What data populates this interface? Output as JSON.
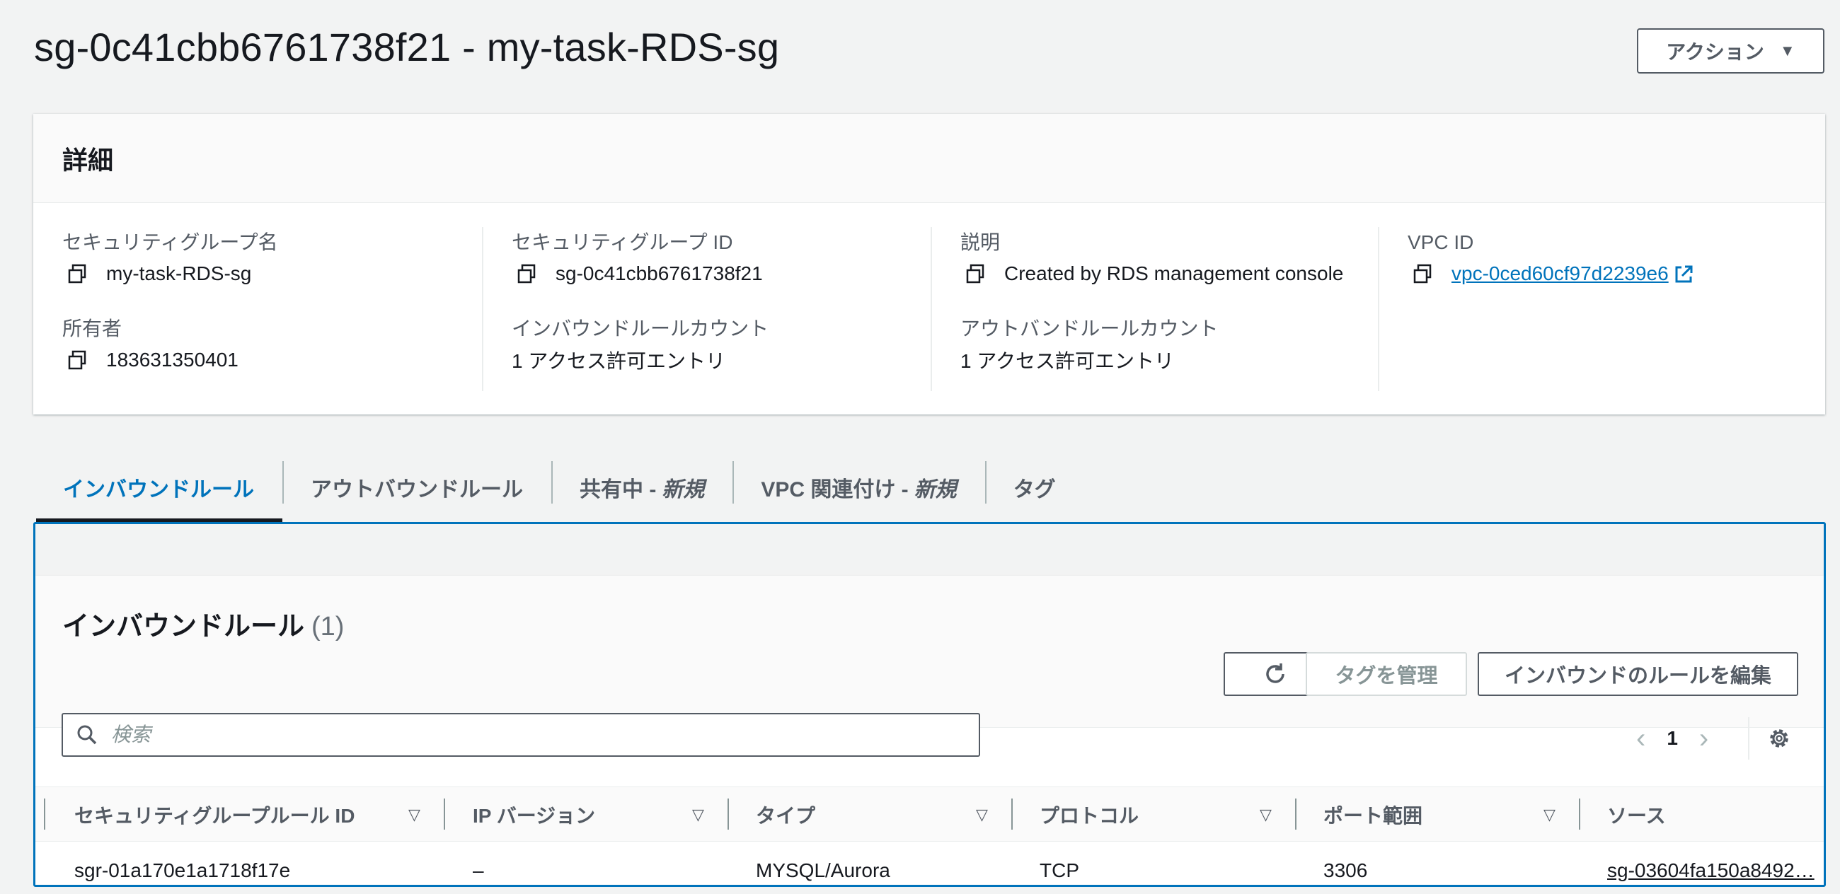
{
  "page": {
    "title": "sg-0c41cbb6761738f21 - my-task-RDS-sg",
    "actions_label": "アクション"
  },
  "details": {
    "heading": "詳細",
    "sg_name_label": "セキュリティグループ名",
    "sg_name_value": "my-task-RDS-sg",
    "sg_id_label": "セキュリティグループ ID",
    "sg_id_value": "sg-0c41cbb6761738f21",
    "description_label": "説明",
    "description_value": "Created by RDS management console",
    "vpc_id_label": "VPC ID",
    "vpc_id_value": "vpc-0ced60cf97d2239e6",
    "owner_label": "所有者",
    "owner_value": "183631350401",
    "inbound_count_label": "インバウンドルールカウント",
    "inbound_count_value": "1 アクセス許可エントリ",
    "outbound_count_label": "アウトバンドルールカウント",
    "outbound_count_value": "1 アクセス許可エントリ"
  },
  "tabs": [
    {
      "label": "インバウンドルール",
      "suffix": ""
    },
    {
      "label": "アウトバウンドルール",
      "suffix": ""
    },
    {
      "label": "共有中 - ",
      "suffix": "新規"
    },
    {
      "label": "VPC 関連付け - ",
      "suffix": "新規"
    },
    {
      "label": "タグ",
      "suffix": ""
    }
  ],
  "inbound": {
    "title": "インバウンドルール",
    "count": "(1)",
    "manage_tags_label": "タグを管理",
    "edit_rules_label": "インバウンドのルールを編集",
    "search_placeholder": "検索",
    "page_number": "1",
    "columns": [
      "セキュリティグループルール ID",
      "IP バージョン",
      "タイプ",
      "プロトコル",
      "ポート範囲",
      "ソース"
    ],
    "rows": [
      {
        "rule_id": "sgr-01a170e1a1718f17e",
        "ip_version": "–",
        "type": "MYSQL/Aurora",
        "protocol": "TCP",
        "port_range": "3306",
        "source": "sg-03604fa150a8492…"
      }
    ]
  },
  "colors": {
    "accent": "#0073bb",
    "text": "#16191f",
    "muted": "#545b64",
    "background": "#f2f3f3"
  }
}
